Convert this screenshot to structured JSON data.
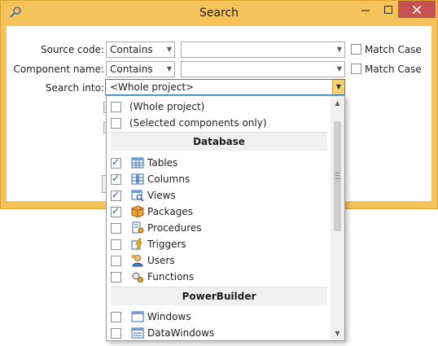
{
  "window": {
    "title": "Search"
  },
  "form": {
    "source_code_label": "Source code:",
    "component_name_label": "Component name:",
    "search_into_label": "Search into:",
    "source_mode": "Contains",
    "component_mode": "Contains",
    "source_value": "",
    "component_value": "",
    "match_case_label": "Match Case",
    "search_into_value": "<Whole project>"
  },
  "dropdown": {
    "top_items": [
      {
        "label": "(Whole project)",
        "checked": false
      },
      {
        "label": "(Selected components only)",
        "checked": false
      }
    ],
    "database_header": "Database",
    "database_items": [
      {
        "label": "Tables",
        "checked": true,
        "icon": "table-icon"
      },
      {
        "label": "Columns",
        "checked": true,
        "icon": "columns-icon"
      },
      {
        "label": "Views",
        "checked": true,
        "icon": "view-icon"
      },
      {
        "label": "Packages",
        "checked": true,
        "icon": "package-icon"
      },
      {
        "label": "Procedures",
        "checked": false,
        "icon": "procedure-icon"
      },
      {
        "label": "Triggers",
        "checked": false,
        "icon": "trigger-icon"
      },
      {
        "label": "Users",
        "checked": false,
        "icon": "user-icon"
      },
      {
        "label": "Functions",
        "checked": false,
        "icon": "function-icon"
      }
    ],
    "powerbuilder_header": "PowerBuilder",
    "powerbuilder_items": [
      {
        "label": "Windows",
        "checked": false,
        "icon": "window-icon"
      },
      {
        "label": "DataWindows",
        "checked": false,
        "icon": "datawindow-icon"
      }
    ],
    "scroll_position": 0.0
  },
  "colors": {
    "frame": "#f5c35a",
    "close": "#c75050",
    "focus": "#3c7fb1"
  }
}
